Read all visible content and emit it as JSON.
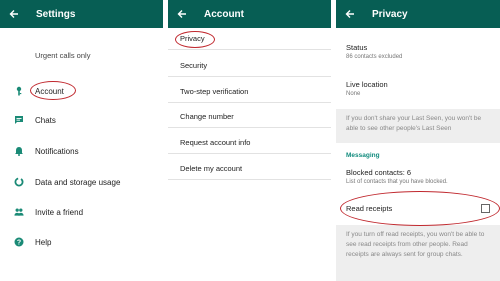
{
  "settings": {
    "title": "Settings",
    "urgent_text": "Urgent calls only",
    "items": [
      {
        "label": "Account",
        "icon": "key-icon"
      },
      {
        "label": "Chats",
        "icon": "chat-icon"
      },
      {
        "label": "Notifications",
        "icon": "bell-icon"
      },
      {
        "label": "Data and storage usage",
        "icon": "data-usage-icon"
      },
      {
        "label": "Invite a friend",
        "icon": "people-icon"
      },
      {
        "label": "Help",
        "icon": "help-icon"
      }
    ]
  },
  "account": {
    "title": "Account",
    "items": [
      {
        "label": "Privacy"
      },
      {
        "label": "Security"
      },
      {
        "label": "Two-step verification"
      },
      {
        "label": "Change number"
      },
      {
        "label": "Request account info"
      },
      {
        "label": "Delete my account"
      }
    ]
  },
  "privacy": {
    "title": "Privacy",
    "status": {
      "title": "Status",
      "subtitle": "86 contacts excluded"
    },
    "live_location": {
      "title": "Live location",
      "subtitle": "None"
    },
    "last_seen_note": "If you don't share your Last Seen, you won't be able to see other people's Last Seen",
    "section_messaging": "Messaging",
    "blocked": {
      "title": "Blocked contacts: 6",
      "subtitle": "List of contacts that you have blocked."
    },
    "read_receipts": {
      "label": "Read receipts",
      "checked": false
    },
    "read_receipts_note": "If you turn off read receipts, you won't be able to see read receipts from other people. Read receipts are always sent for group chats."
  },
  "colors": {
    "appbar": "#075e54",
    "accent": "#128c7e",
    "highlight_oval": "#c0282e"
  }
}
